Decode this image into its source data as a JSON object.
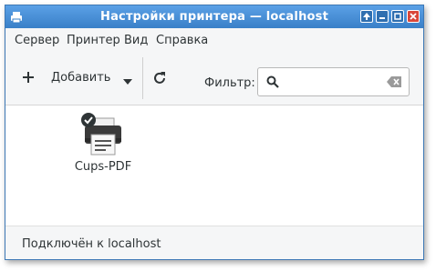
{
  "window": {
    "title": "Настройки принтера — localhost",
    "buttons": [
      "keep-above",
      "minimize",
      "maximize",
      "close"
    ]
  },
  "menu": {
    "items": [
      {
        "label": "Сервер"
      },
      {
        "label": "Принтер"
      },
      {
        "label": "Вид"
      },
      {
        "label": "Справка"
      }
    ]
  },
  "toolbar": {
    "add_label": "Добавить",
    "add_icon": "plus-icon",
    "dropdown_icon": "chevron-down-icon",
    "refresh_icon": "refresh-icon",
    "filter_label": "Фильтр:",
    "filter_value": "",
    "filter_placeholder": ""
  },
  "printers": [
    {
      "name": "Cups-PDF",
      "is_default": true,
      "icon": "printer-icon"
    }
  ],
  "status": {
    "text": "Подключён к localhost"
  },
  "colors": {
    "titlebar": "#3a80c8",
    "close_button": "#d9473a",
    "window_bg": "#f5f6f7",
    "content_bg": "#ffffff"
  }
}
